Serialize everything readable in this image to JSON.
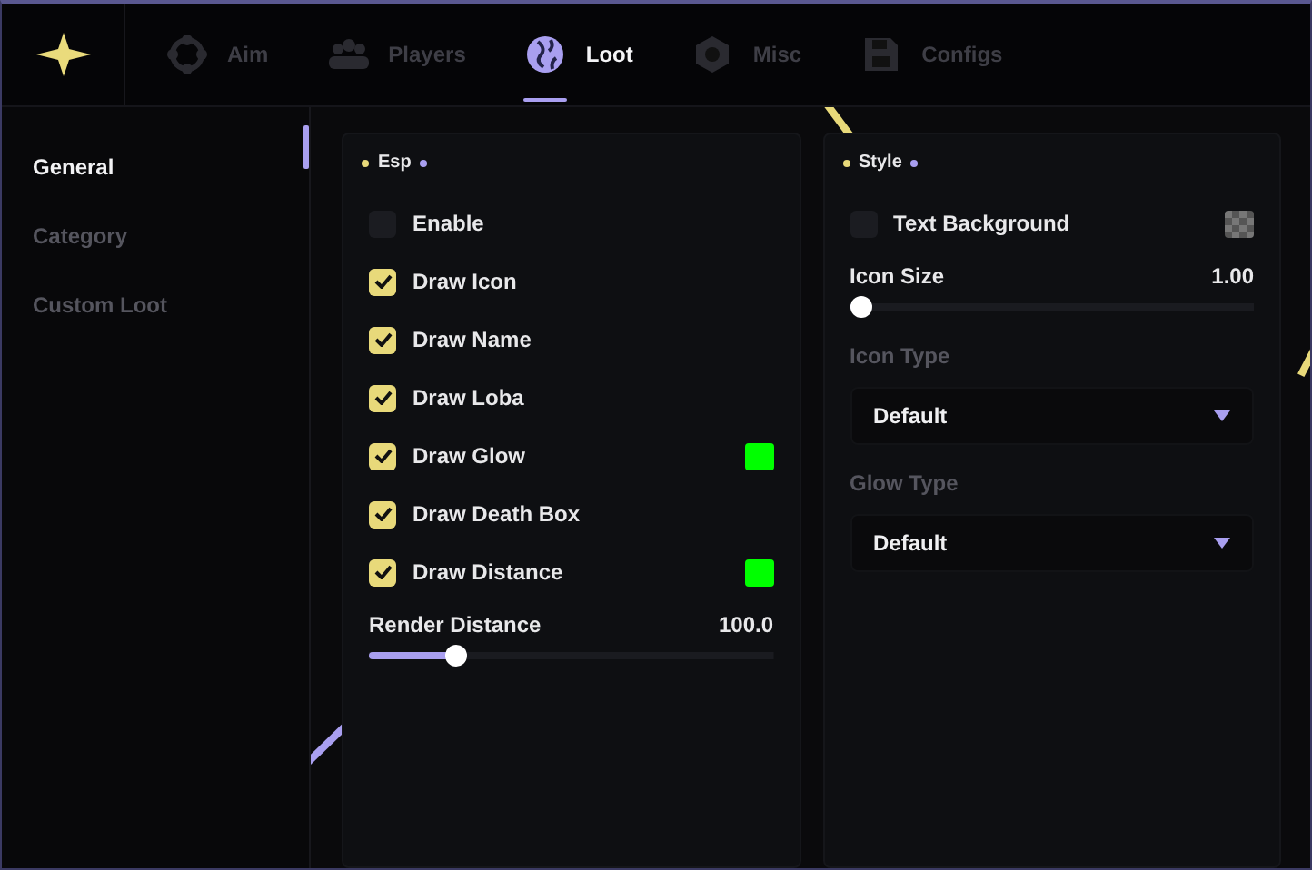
{
  "tabs": [
    {
      "label": "Aim",
      "selected": false
    },
    {
      "label": "Players",
      "selected": false
    },
    {
      "label": "Loot",
      "selected": true
    },
    {
      "label": "Misc",
      "selected": false
    },
    {
      "label": "Configs",
      "selected": false
    }
  ],
  "sidebar": {
    "items": [
      {
        "label": "General",
        "selected": true
      },
      {
        "label": "Category",
        "selected": false
      },
      {
        "label": "Custom Loot",
        "selected": false
      }
    ]
  },
  "panels": [
    {
      "title": "Esp",
      "controls": [
        {
          "kind": "checkbox",
          "label": "Enable",
          "checked": false
        },
        {
          "kind": "checkbox",
          "label": "Draw Icon",
          "checked": true
        },
        {
          "kind": "checkbox",
          "label": "Draw Name",
          "checked": true
        },
        {
          "kind": "checkbox",
          "label": "Draw Loba",
          "checked": true
        },
        {
          "kind": "checkbox",
          "label": "Draw Glow",
          "checked": true,
          "swatch": {
            "kind": "color",
            "color": "#00ff00"
          }
        },
        {
          "kind": "checkbox",
          "label": "Draw Death Box",
          "checked": true
        },
        {
          "kind": "checkbox",
          "label": "Draw Distance",
          "checked": true,
          "swatch": {
            "kind": "color",
            "color": "#00ff00"
          }
        },
        {
          "kind": "slider",
          "label": "Render Distance",
          "reading": "100.0",
          "level": 0.2
        }
      ]
    },
    {
      "title": "Style",
      "controls": [
        {
          "kind": "checkbox",
          "label": "Text Background",
          "checked": false,
          "swatch": {
            "kind": "transparent"
          }
        },
        {
          "kind": "slider",
          "label": "Icon Size",
          "reading": "1.00",
          "level": 0
        },
        {
          "kind": "dropdown",
          "label": "Icon Type",
          "value": "Default"
        },
        {
          "kind": "dropdown",
          "label": "Glow Type",
          "value": "Default"
        }
      ]
    }
  ]
}
